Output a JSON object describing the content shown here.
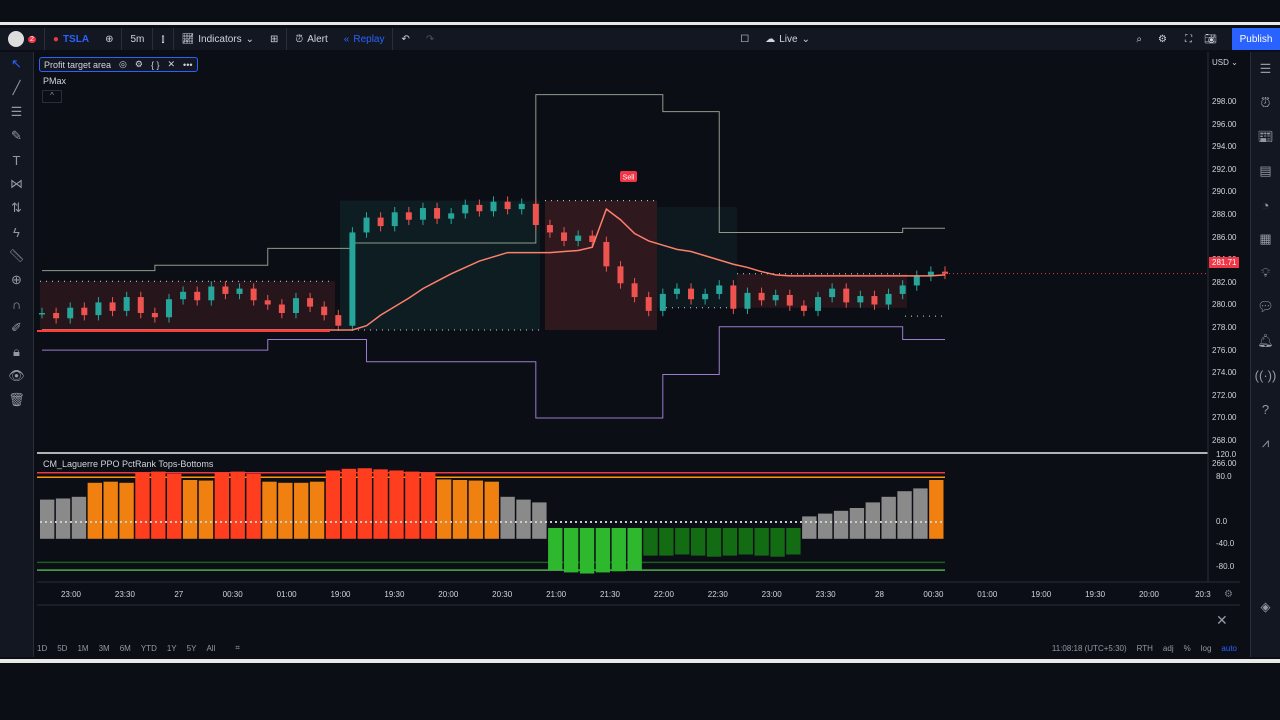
{
  "toolbar": {
    "notifications": "2",
    "symbol": "TSLA",
    "interval": "5m",
    "indicators": "Indicators",
    "alert": "Alert",
    "replay": "Replay",
    "layout": "Live",
    "publish": "Publish"
  },
  "legend": {
    "title": "Profit target area",
    "pmax": "PMax",
    "collapse": "^"
  },
  "oscillator": {
    "title": "CM_Laguerre PPO PctRank Tops-Bottoms",
    "ticks": [
      "120.0",
      "80.0",
      "0.0",
      "-40.0",
      "-80.0"
    ]
  },
  "price_axis": {
    "currency": "USD",
    "ticks": [
      "298.00",
      "296.00",
      "294.00",
      "292.00",
      "290.00",
      "288.00",
      "286.00",
      "284.00",
      "282.00",
      "280.00",
      "278.00",
      "276.00",
      "274.00",
      "272.00",
      "270.00",
      "268.00",
      "266.00"
    ],
    "last_price": "281.71",
    "last_color": "#f23645"
  },
  "sell_label": "Sell",
  "time_axis": [
    "23:00",
    "23:30",
    "27",
    "00:30",
    "01:00",
    "19:00",
    "19:30",
    "20:00",
    "20:30",
    "21:00",
    "21:30",
    "22:00",
    "22:30",
    "23:00",
    "23:30",
    "28",
    "00:30",
    "01:00",
    "19:00",
    "19:30",
    "20:00",
    "20:3"
  ],
  "bottom": {
    "ranges": [
      "1D",
      "5D",
      "1M",
      "3M",
      "6M",
      "YTD",
      "1Y",
      "5Y",
      "All"
    ],
    "clock": "11:08:18 (UTC+5:30)",
    "session": "RTH",
    "adj": "adj",
    "pct": "%",
    "log": "log",
    "auto": "auto"
  },
  "colors": {
    "up": "#26a69a",
    "down": "#ef5350",
    "pmax": "#ff7f6a",
    "upper": "#8c9c8c",
    "lower": "#9c7ccc",
    "accent": "#2962ff"
  },
  "chart_data": {
    "type": "candlestick",
    "closes": [
      278,
      277.5,
      278.5,
      277.8,
      279,
      278.2,
      279.5,
      278,
      277.6,
      279.3,
      280,
      279.2,
      280.5,
      279.8,
      280.3,
      279.2,
      278.8,
      278,
      279.4,
      278.6,
      277.8,
      276.8,
      285.6,
      287,
      286.2,
      287.5,
      286.8,
      287.9,
      286.9,
      287.4,
      288.2,
      287.6,
      288.5,
      287.8,
      288.3,
      286.3,
      285.6,
      284.8,
      285.3,
      284.7,
      282.4,
      280.8,
      279.5,
      278.2,
      279.8,
      280.3,
      279.3,
      279.8,
      280.6,
      278.4,
      279.9,
      279.2,
      279.7,
      278.7,
      278.2,
      279.5,
      280.3,
      279,
      279.6,
      278.8,
      279.8,
      280.6,
      281.5,
      281.9,
      281.7
    ],
    "pmax": [
      276.4,
      276.4,
      276.4,
      276.4,
      276.4,
      276.4,
      276.4,
      276.4,
      276.4,
      276.4,
      276.4,
      276.4,
      276.4,
      276.4,
      276.4,
      276.4,
      276.4,
      276.4,
      276.4,
      276.4,
      276.4,
      276.4,
      276.4,
      276.8,
      277.8,
      278.6,
      279.4,
      280.3,
      281,
      281.7,
      282.3,
      282.9,
      283.3,
      283.7,
      283.7,
      283.7,
      283.7,
      283.8,
      283.9,
      284.2,
      287.8,
      286.8,
      285.5,
      284.8,
      284.4,
      284,
      283.8,
      283.4,
      283,
      282.6,
      282.3,
      281.9,
      281.6,
      281.5,
      281.5,
      281.5,
      281.5,
      281.5,
      281.5,
      281.5,
      281.5,
      281.5,
      281.5,
      281.5,
      281.6
    ],
    "upper": [
      282,
      282,
      282,
      282,
      282,
      282,
      282,
      282,
      282.5,
      282.5,
      282.5,
      282.5,
      282.5,
      282.5,
      282.5,
      282.5,
      284.1,
      284.1,
      284.1,
      284.1,
      284.1,
      284.1,
      284.6,
      284.6,
      284.6,
      284.6,
      284.6,
      284.6,
      284.6,
      284.6,
      284.6,
      284.6,
      284.6,
      284.6,
      284.6,
      298.6,
      298.6,
      298.6,
      298.6,
      298.6,
      298.6,
      298.6,
      298.6,
      298.6,
      297,
      297,
      297,
      297,
      285.6,
      285.6,
      285.6,
      285.6,
      285.6,
      285.6,
      285.6,
      285.6,
      285.6,
      285.6,
      285.6,
      285.6,
      285.6,
      286,
      286,
      286,
      286
    ],
    "lower": [
      274.5,
      274.5,
      274.5,
      274.5,
      274.5,
      274.5,
      274.5,
      274.5,
      274.5,
      274.5,
      274.5,
      274.5,
      274.5,
      274.5,
      274.5,
      274.5,
      275.5,
      275.5,
      275.5,
      275.5,
      275.5,
      275.5,
      275.5,
      273.4,
      273.4,
      273.4,
      273.4,
      273.4,
      273.4,
      273.4,
      273.4,
      273.4,
      273.4,
      273.4,
      273.4,
      268.1,
      268.1,
      268.1,
      268.1,
      268.1,
      268.1,
      268.1,
      268.1,
      268.1,
      272.2,
      272.2,
      272.2,
      272.2,
      276.7,
      276.7,
      276.7,
      276.7,
      276.7,
      276.7,
      276.7,
      276.7,
      276.7,
      276.7,
      276.7,
      276.7,
      276.7,
      275.5,
      275.5,
      275.5,
      275.5
    ],
    "osc": [
      40,
      42,
      45,
      70,
      72,
      70,
      88,
      90,
      86,
      75,
      74,
      88,
      90,
      86,
      72,
      70,
      70,
      72,
      92,
      95,
      96,
      94,
      92,
      90,
      88,
      76,
      75,
      74,
      72,
      45,
      40,
      35,
      -85,
      -90,
      -92,
      -90,
      -88,
      -85,
      -60,
      -60,
      -58,
      -60,
      -62,
      -60,
      -58,
      -60,
      -62,
      -58,
      10,
      15,
      20,
      25,
      35,
      45,
      55,
      60,
      75
    ],
    "ylim": [
      266,
      298
    ],
    "osc_ylim": [
      -80,
      120
    ]
  }
}
